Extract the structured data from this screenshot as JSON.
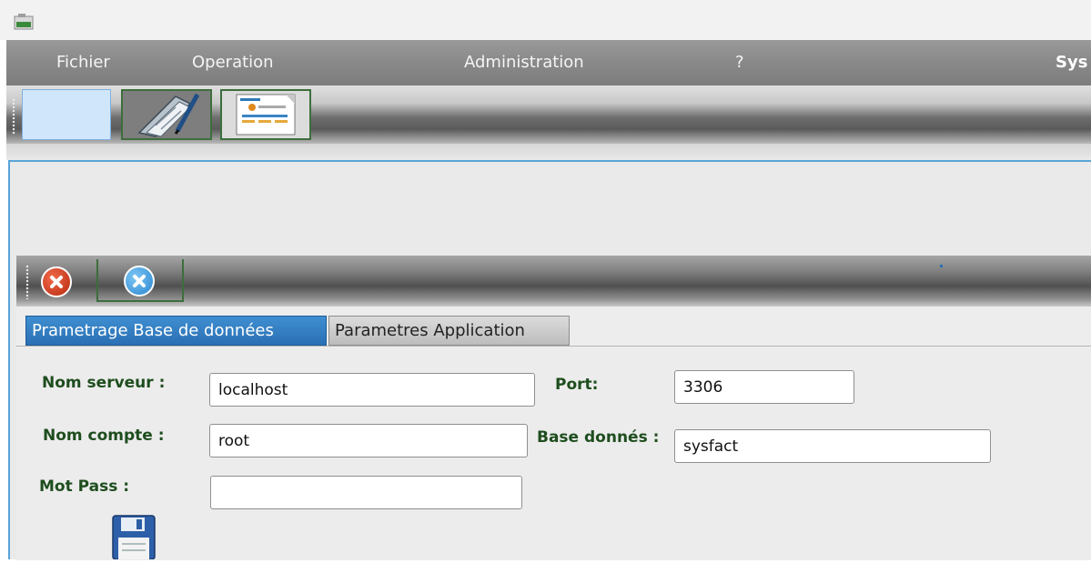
{
  "menu": {
    "items": [
      "Fichier",
      "Operation",
      "Administration",
      "?"
    ],
    "app_title_fragment": "Sys"
  },
  "toolbar": {
    "buttons": [
      {
        "icon": "blank-icon"
      },
      {
        "icon": "document-edit-icon"
      },
      {
        "icon": "invoice-icon"
      }
    ]
  },
  "inner_toolbar": {
    "buttons": [
      {
        "icon": "close-circle-red-icon"
      },
      {
        "icon": "close-circle-blue-icon"
      }
    ]
  },
  "tabs": {
    "items": [
      {
        "label": "Prametrage Base de données",
        "active": true
      },
      {
        "label": "Parametres Application",
        "active": false
      }
    ]
  },
  "form": {
    "server_label": "Nom serveur :",
    "server_value": "localhost",
    "port_label": "Port:",
    "port_value": "3306",
    "account_label": "Nom compte :",
    "account_value": "root",
    "database_label": "Base donnés :",
    "database_value": "sysfact",
    "password_label": "Mot Pass :",
    "password_value": ""
  },
  "colors": {
    "label_green": "#1e4d1e",
    "active_tab_blue": "#2a6fb3",
    "menubar_gray": "#8a8a8a"
  }
}
